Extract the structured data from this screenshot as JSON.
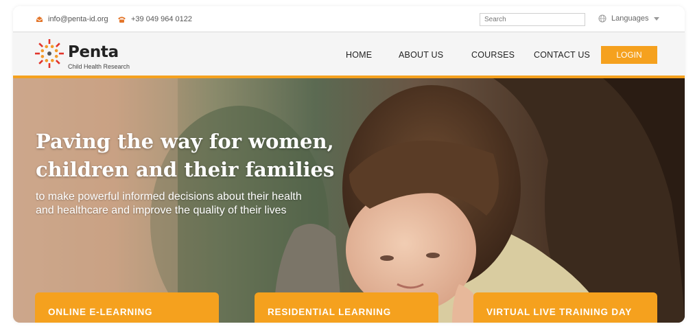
{
  "contact": {
    "email": "info@penta-id.org",
    "phone": "+39 049 964 0122"
  },
  "search": {
    "placeholder": "Search"
  },
  "languages_label": "Languages",
  "brand": {
    "name": "Penta",
    "tagline": "Child Health Research"
  },
  "nav": {
    "items": [
      {
        "label": "HOME"
      },
      {
        "label": "ABOUT US"
      },
      {
        "label": "COURSES"
      },
      {
        "label": "CONTACT US"
      }
    ],
    "login_label": "LOGIN"
  },
  "hero": {
    "headline_line1": "Paving the way for women,",
    "headline_line2": "children and their families",
    "sub_line1": "to make powerful informed decisions about their health",
    "sub_line2": "and healthcare and improve the quality of their lives"
  },
  "cards": [
    {
      "label": "ONLINE E-LEARNING"
    },
    {
      "label": "RESIDENTIAL LEARNING"
    },
    {
      "label": "VIRTUAL LIVE TRAINING DAY"
    }
  ],
  "colors": {
    "accent": "#f5a11e",
    "nav_bg": "#f5f5f5",
    "text_dark": "#222222"
  },
  "icons": {
    "email": "envelope-icon",
    "phone": "phone-icon",
    "language": "globe-icon",
    "dropdown": "chevron-down-icon"
  }
}
